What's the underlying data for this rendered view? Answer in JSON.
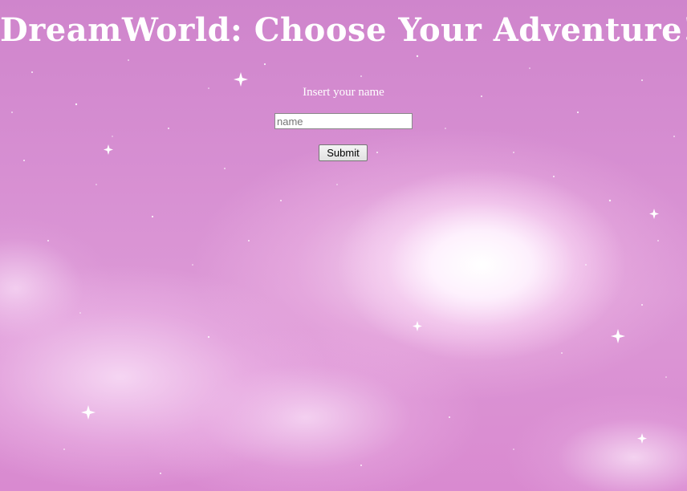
{
  "page": {
    "title": "DreamWorld: Choose Your Adventure!",
    "background_colors": {
      "base": "#d78fd2",
      "glow": "#ffffff"
    }
  },
  "form": {
    "label": "Insert your name",
    "name_input": {
      "value": "",
      "placeholder": "name"
    },
    "submit_label": "Submit"
  }
}
